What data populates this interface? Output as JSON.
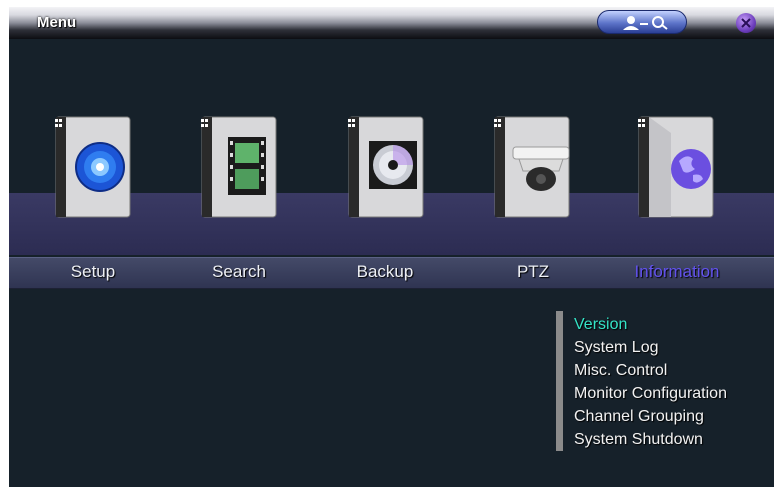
{
  "window": {
    "title": "Menu"
  },
  "menu": {
    "items": [
      {
        "label": "Setup",
        "icon": "setup-icon"
      },
      {
        "label": "Search",
        "icon": "film-icon"
      },
      {
        "label": "Backup",
        "icon": "disc-icon"
      },
      {
        "label": "PTZ",
        "icon": "camera-icon"
      },
      {
        "label": "Information",
        "icon": "globe-icon",
        "active": true
      }
    ]
  },
  "submenu": {
    "items": [
      {
        "label": "Version",
        "selected": true
      },
      {
        "label": "System Log"
      },
      {
        "label": "Misc. Control"
      },
      {
        "label": "Monitor Configuration"
      },
      {
        "label": "Channel Grouping"
      },
      {
        "label": "System Shutdown"
      }
    ]
  },
  "colors": {
    "background": "#16212a",
    "active_label": "#6252ee",
    "selected_item": "#34e3c6"
  }
}
